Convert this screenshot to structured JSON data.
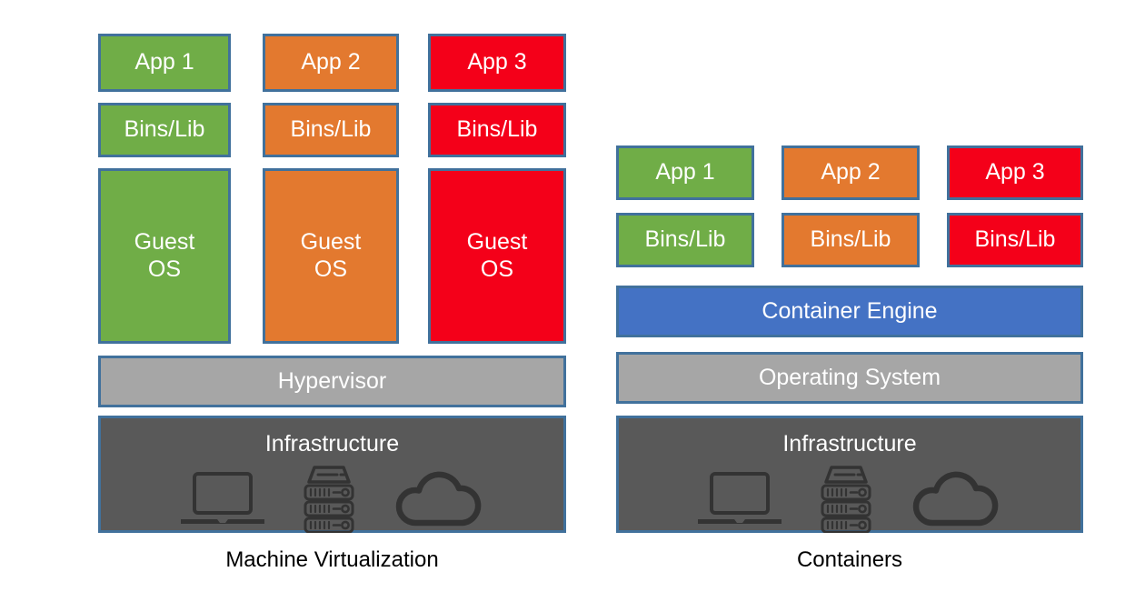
{
  "diagram": {
    "title_left": "Machine Virtualization",
    "title_right": "Containers",
    "colors": {
      "green": "#70AD47",
      "orange": "#E3792F",
      "red": "#F40019",
      "gray": "#A6A6A6",
      "dark_gray": "#595959",
      "blue": "#4472C4",
      "border": "#41719C",
      "text_on_box": "#FFFFFF",
      "caption_text": "#000000",
      "background": "#FFFFFF",
      "icon": "#333333"
    }
  },
  "left_panel": {
    "name": "Machine Virtualization",
    "caption": "Machine Virtualization",
    "columns": [
      {
        "color_name": "green",
        "app": "App 1",
        "bins": "Bins/Lib",
        "guest_line1": "Guest",
        "guest_line2": "OS"
      },
      {
        "color_name": "orange",
        "app": "App 2",
        "bins": "Bins/Lib",
        "guest_line1": "Guest",
        "guest_line2": "OS"
      },
      {
        "color_name": "red",
        "app": "App 3",
        "bins": "Bins/Lib",
        "guest_line1": "Guest",
        "guest_line2": "OS"
      }
    ],
    "hypervisor": "Hypervisor",
    "infrastructure": "Infrastructure",
    "infrastructure_icons": [
      "laptop-icon",
      "server-rack-icon",
      "cloud-icon"
    ]
  },
  "right_panel": {
    "name": "Containers",
    "caption": "Containers",
    "columns": [
      {
        "color_name": "green",
        "app": "App 1",
        "bins": "Bins/Lib"
      },
      {
        "color_name": "orange",
        "app": "App 2",
        "bins": "Bins/Lib"
      },
      {
        "color_name": "red",
        "app": "App 3",
        "bins": "Bins/Lib"
      }
    ],
    "container_engine": "Container Engine",
    "operating_system": "Operating System",
    "infrastructure": "Infrastructure",
    "infrastructure_icons": [
      "laptop-icon",
      "server-rack-icon",
      "cloud-icon"
    ]
  }
}
